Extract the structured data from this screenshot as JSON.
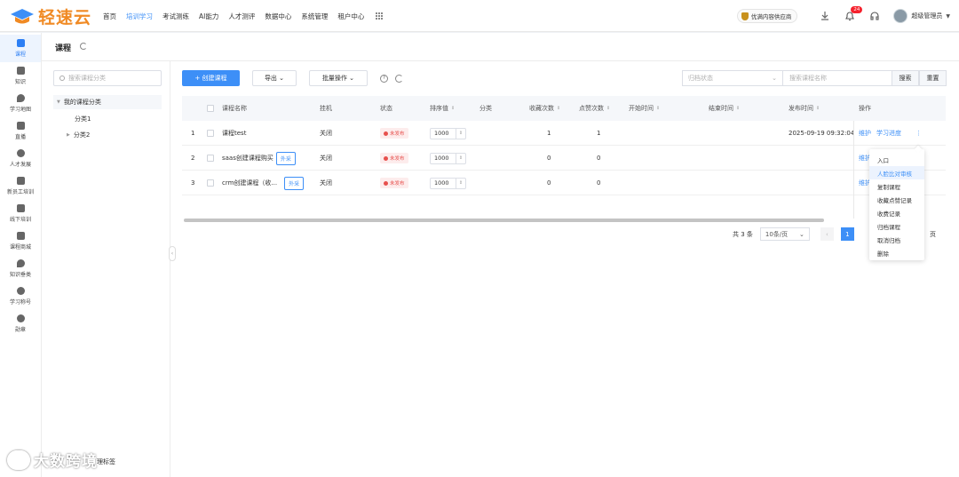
{
  "app": {
    "logo_text": "轻速云",
    "brand_color": "#f08a24",
    "accent_color": "#3d8ff7"
  },
  "topnav": {
    "items": [
      "首页",
      "培训学习",
      "考试测练",
      "AI能力",
      "人才测评",
      "数据中心",
      "系统管理",
      "租户中心"
    ],
    "active_index": 1
  },
  "topright": {
    "promo": "优满内容供应商",
    "notification_count": "24",
    "user_name": "超级管理员"
  },
  "leftnav": {
    "items": [
      {
        "label": "课程",
        "icon": "graduation-cap-icon"
      },
      {
        "label": "知识",
        "icon": "book-icon"
      },
      {
        "label": "学习地图",
        "icon": "map-pin-icon"
      },
      {
        "label": "直播",
        "icon": "camera-icon"
      },
      {
        "label": "人才发展",
        "icon": "sprout-icon"
      },
      {
        "label": "新员工培训",
        "icon": "edit-icon"
      },
      {
        "label": "线下培训",
        "icon": "monitor-icon"
      },
      {
        "label": "课程商城",
        "icon": "store-icon"
      },
      {
        "label": "知识垂类",
        "icon": "pin-icon"
      },
      {
        "label": "学习称号",
        "icon": "medal-icon"
      },
      {
        "label": "勋章",
        "icon": "badge-icon"
      }
    ],
    "active_index": 0
  },
  "page": {
    "title": "课程"
  },
  "category": {
    "search_placeholder": "搜索课程分类",
    "root": "我的课程分类",
    "children": [
      "分类1",
      "分类2"
    ],
    "footer_partial": "理标签"
  },
  "toolbar": {
    "create": "+ 创建课程",
    "export": "导出",
    "batch": "批量操作",
    "help_glyph": "?"
  },
  "filters": {
    "status_placeholder": "归档状态",
    "name_placeholder": "搜索课程名称",
    "search": "搜索",
    "reset": "重置"
  },
  "table": {
    "columns": [
      "课程名称",
      "挂机",
      "状态",
      "排序值",
      "分类",
      "收藏次数",
      "点赞次数",
      "开始时间",
      "结束时间",
      "发布时间",
      "操作"
    ],
    "rows": [
      {
        "index": "1",
        "name": "课程test",
        "tag": "",
        "hook": "关闭",
        "status": "未发布",
        "sort": "1000",
        "category": "",
        "fav": "1",
        "likes": "1",
        "start": "",
        "end": "",
        "publish": "2025-09-19 09:32:04",
        "ops": [
          "维护",
          "学习进度"
        ]
      },
      {
        "index": "2",
        "name": "saas创建课程购买",
        "tag": "外采",
        "hook": "关闭",
        "status": "未发布",
        "sort": "1000",
        "category": "",
        "fav": "0",
        "likes": "0",
        "start": "",
        "end": "",
        "publish": "",
        "ops": [
          "维护"
        ]
      },
      {
        "index": "3",
        "name": "crm创建课程（收...",
        "tag": "外采",
        "hook": "关闭",
        "status": "未发布",
        "sort": "1000",
        "category": "",
        "fav": "0",
        "likes": "0",
        "start": "",
        "end": "",
        "publish": "",
        "ops": [
          "维护"
        ]
      }
    ]
  },
  "pagination": {
    "total": "共 3 条",
    "page_size": "10条/页",
    "current": "1",
    "suffix": "页"
  },
  "dropdown": {
    "items": [
      "入口",
      "人脸比对审核",
      "复制课程",
      "收藏点赞记录",
      "收费记录",
      "归档课程",
      "取消归档",
      "删除"
    ],
    "highlighted_index": 1
  },
  "watermark": {
    "text": "大数跨境"
  }
}
